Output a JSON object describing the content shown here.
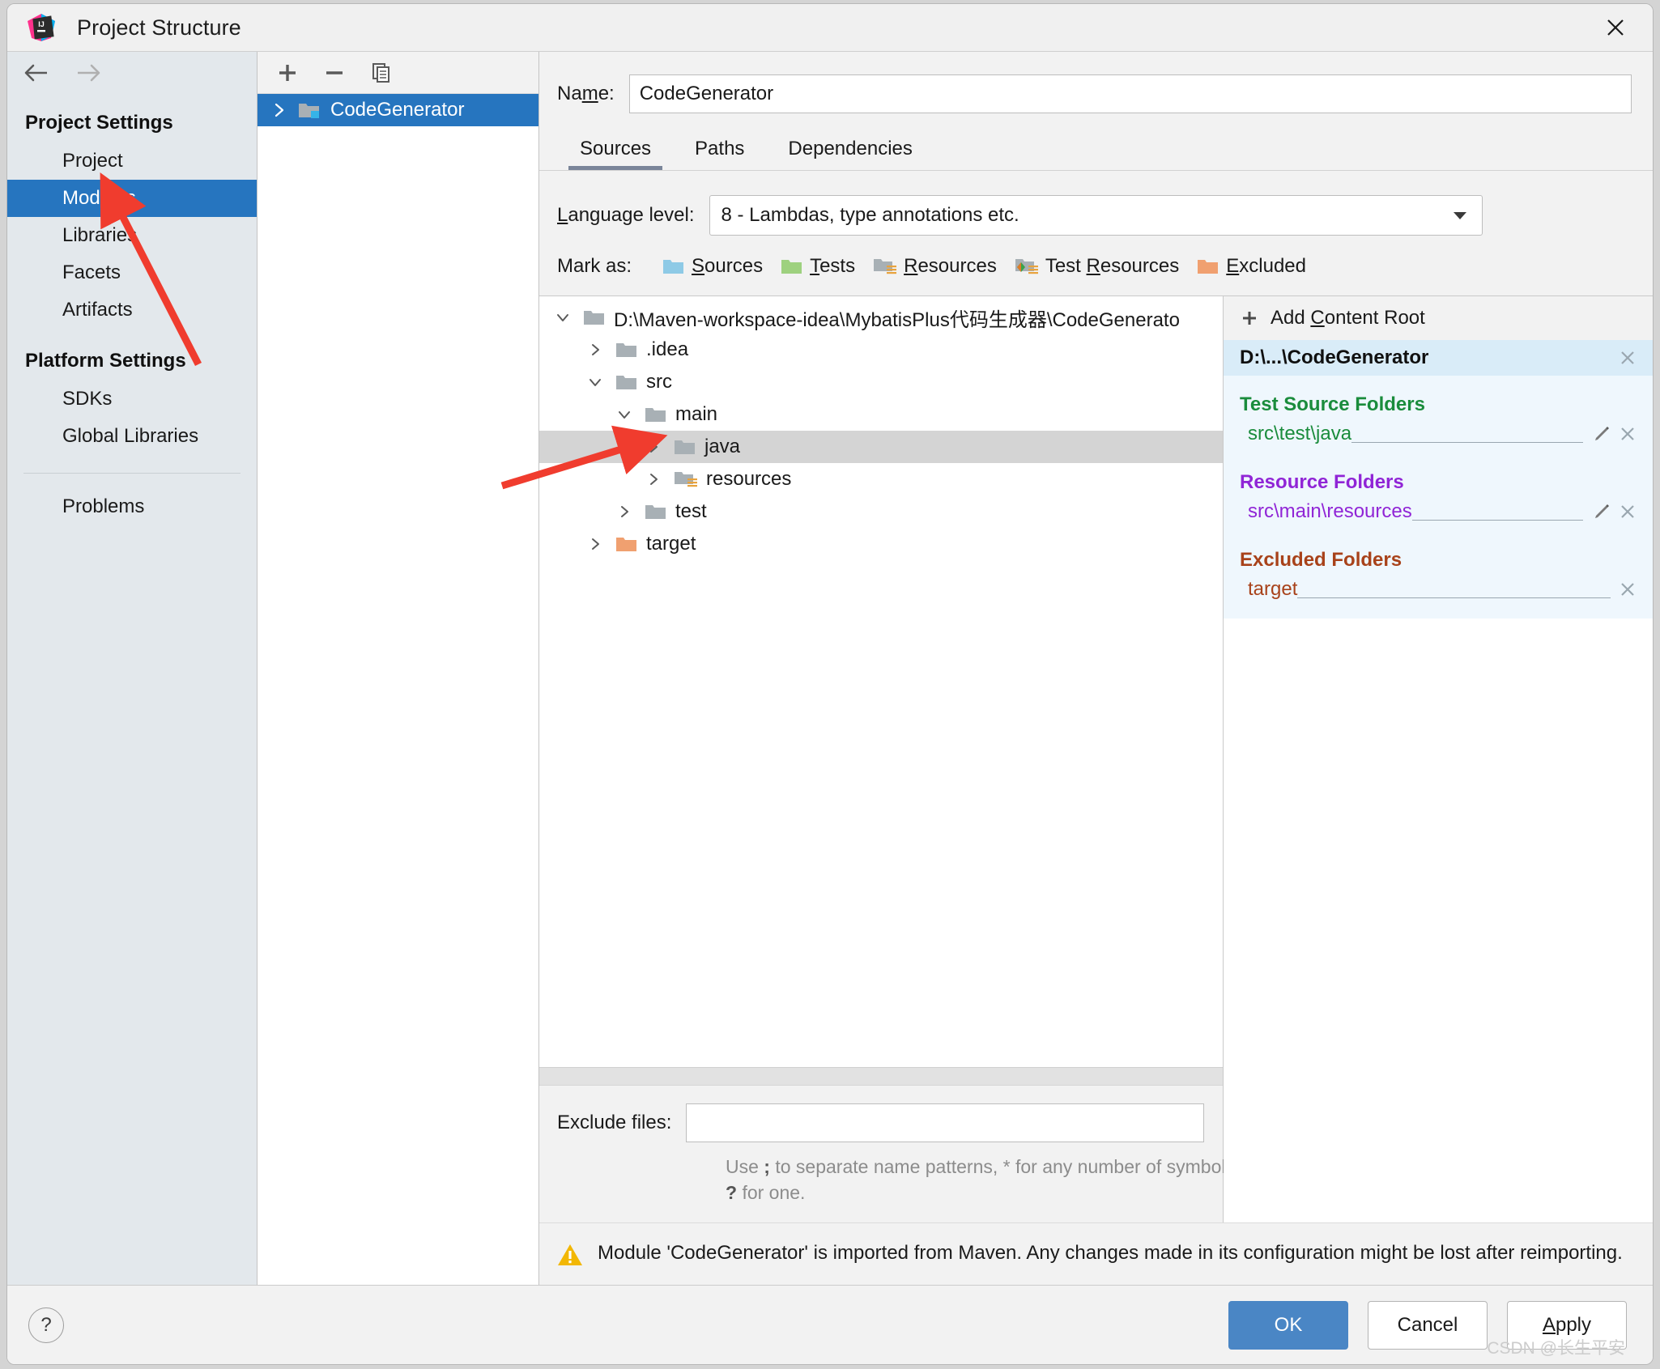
{
  "window": {
    "title": "Project Structure",
    "logo_icon": "intellij-idea-logo",
    "close_icon": "close-icon"
  },
  "sidebar": {
    "back_icon": "arrow-left-icon",
    "forward_icon": "arrow-right-icon",
    "groups": [
      {
        "title": "Project Settings",
        "items": [
          {
            "label": "Project",
            "selected": false
          },
          {
            "label": "Modules",
            "selected": true
          },
          {
            "label": "Libraries",
            "selected": false
          },
          {
            "label": "Facets",
            "selected": false
          },
          {
            "label": "Artifacts",
            "selected": false
          }
        ]
      },
      {
        "title": "Platform Settings",
        "items": [
          {
            "label": "SDKs",
            "selected": false
          },
          {
            "label": "Global Libraries",
            "selected": false
          }
        ]
      }
    ],
    "problems_label": "Problems"
  },
  "module_list": {
    "toolbar": {
      "add_icon": "plus-icon",
      "remove_icon": "minus-icon",
      "copy_icon": "copy-icon"
    },
    "modules": [
      {
        "name": "CodeGenerator",
        "expanded": false,
        "selected": true,
        "icon": "module-folder-icon"
      }
    ]
  },
  "main": {
    "name_label": "Name:",
    "name_label_pre": "Na",
    "name_label_accel": "m",
    "name_label_post": "e:",
    "name_value": "CodeGenerator",
    "tabs": [
      {
        "label": "Sources",
        "active": true
      },
      {
        "label": "Paths",
        "active": false
      },
      {
        "label": "Dependencies",
        "active": false
      }
    ],
    "language_level": {
      "label_pre": "",
      "label_accel": "L",
      "label_post": "anguage level:",
      "value": "8 - Lambdas, type annotations etc.",
      "chevron_icon": "chevron-down-icon"
    },
    "mark_as": {
      "label": "Mark as:",
      "buttons": [
        {
          "label_pre": "",
          "accel": "S",
          "label_post": "ources",
          "icon": "sources-folder-icon",
          "color": "#8ecae6"
        },
        {
          "label_pre": "",
          "accel": "T",
          "label_post": "ests",
          "icon": "tests-folder-icon",
          "color": "#9ed17f"
        },
        {
          "label_pre": "",
          "accel": "R",
          "label_post": "esources",
          "icon": "resources-folder-icon",
          "color": "#a8b0b5"
        },
        {
          "label_pre": "Test ",
          "accel": "R",
          "label_post": "esources",
          "icon": "test-resources-folder-icon",
          "color": "#a8b0b5"
        },
        {
          "label_pre": "",
          "accel": "E",
          "label_post": "xcluded",
          "icon": "excluded-folder-icon",
          "color": "#f0a070"
        }
      ]
    },
    "tree": [
      {
        "label": "D:\\Maven-workspace-idea\\MybatisPlus代码生成器\\CodeGenerato",
        "depth": 0,
        "twisty": "down",
        "icon_color": "#a8b0b5",
        "icon": "folder-icon",
        "selected": false,
        "resource": false
      },
      {
        "label": ".idea",
        "depth": 1,
        "twisty": "right",
        "icon_color": "#a8b0b5",
        "icon": "folder-icon",
        "selected": false,
        "resource": false
      },
      {
        "label": "src",
        "depth": 1,
        "twisty": "down",
        "icon_color": "#a8b0b5",
        "icon": "folder-icon",
        "selected": false,
        "resource": false
      },
      {
        "label": "main",
        "depth": 2,
        "twisty": "down",
        "icon_color": "#a8b0b5",
        "icon": "folder-icon",
        "selected": false,
        "resource": false
      },
      {
        "label": "java",
        "depth": 3,
        "twisty": "right",
        "icon_color": "#a8b0b5",
        "icon": "folder-icon",
        "selected": true,
        "resource": false
      },
      {
        "label": "resources",
        "depth": 3,
        "twisty": "right",
        "icon_color": "#a8b0b5",
        "icon": "resources-folder-icon",
        "selected": false,
        "resource": true
      },
      {
        "label": "test",
        "depth": 2,
        "twisty": "right",
        "icon_color": "#a8b0b5",
        "icon": "folder-icon",
        "selected": false,
        "resource": false
      },
      {
        "label": "target",
        "depth": 1,
        "twisty": "right",
        "icon_color": "#f0a070",
        "icon": "excluded-folder-icon",
        "selected": false,
        "resource": false
      }
    ],
    "exclude_files": {
      "label": "Exclude files:",
      "value": "",
      "hint_part1": "Use ",
      "hint_semicolon": ";",
      "hint_part2": " to separate name patterns, * for any number of symbols, ",
      "hint_question": "?",
      "hint_part3": " for one."
    },
    "warning": {
      "icon": "warning-triangle-icon",
      "text": "Module 'CodeGenerator' is imported from Maven. Any changes made in its configuration might be lost after reimporting."
    }
  },
  "content_roots": {
    "add_button": {
      "icon": "plus-icon",
      "label_pre": "Add ",
      "accel": "C",
      "label_post": "ontent Root"
    },
    "root_path": "D:\\...\\CodeGenerator",
    "root_remove_icon": "close-icon",
    "sections": [
      {
        "title": "Test Source Folders",
        "color": "#1a8c3c",
        "entries": [
          {
            "path": "src\\test\\java",
            "has_edit": true,
            "edit_icon": "pencil-icon",
            "remove_icon": "close-icon"
          }
        ]
      },
      {
        "title": "Resource Folders",
        "color": "#9025d6",
        "entries": [
          {
            "path": "src\\main\\resources",
            "has_edit": true,
            "edit_icon": "pencil-icon",
            "remove_icon": "close-icon"
          }
        ]
      },
      {
        "title": "Excluded Folders",
        "color": "#a8421a",
        "entries": [
          {
            "path": "target",
            "has_edit": false,
            "edit_icon": "",
            "remove_icon": "close-icon"
          }
        ]
      }
    ]
  },
  "footer": {
    "help_label": "?",
    "help_icon": "help-icon",
    "ok_label": "OK",
    "cancel_label": "Cancel",
    "apply_label_pre": "",
    "apply_accel": "A",
    "apply_label_post": "pply",
    "watermark": "CSDN @长生平安"
  },
  "colors": {
    "selection_blue": "#2675bf",
    "primary_button": "#4a86c5",
    "sidebar_bg": "#e3e8ec",
    "dialog_bg": "#f2f2f2",
    "root_card_bg": "#eff7fd",
    "root_header_bg": "#d9ecf8",
    "annotation_red": "#f03c2e"
  }
}
